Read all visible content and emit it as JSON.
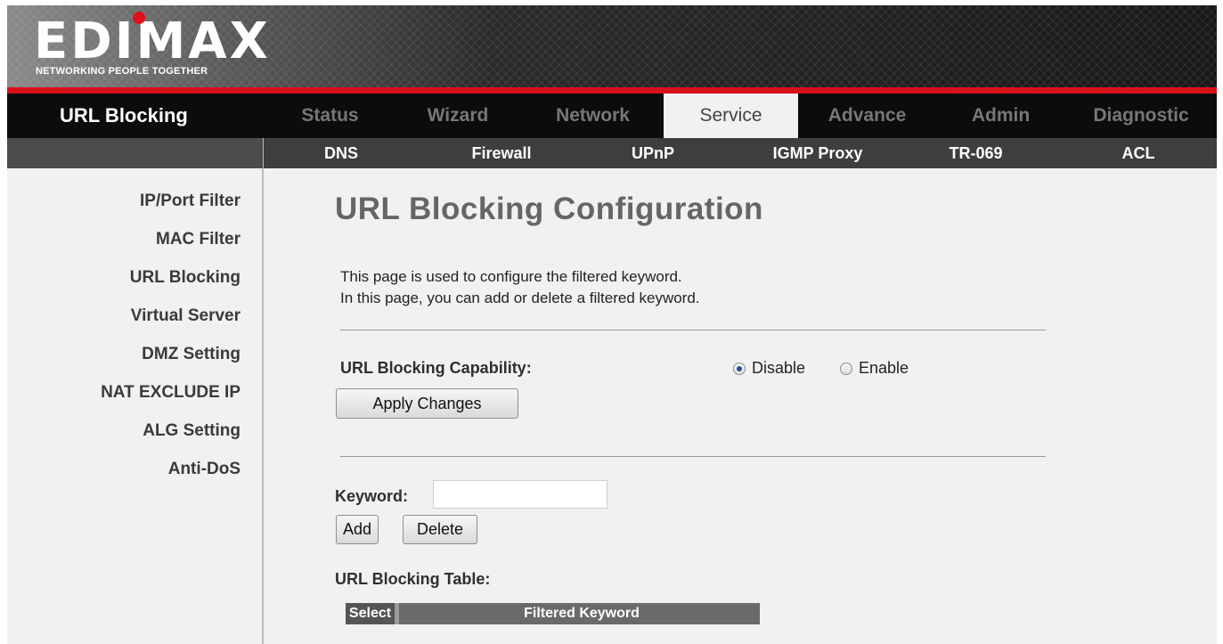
{
  "brand": {
    "logo_text": "EDIMAX",
    "tagline": "NETWORKING PEOPLE TOGETHER",
    "accent_color": "#d8101a"
  },
  "header": {
    "page_title": "URL Blocking"
  },
  "main_nav": {
    "tabs": [
      {
        "label": "Status",
        "active": false
      },
      {
        "label": "Wizard",
        "active": false
      },
      {
        "label": "Network",
        "active": false
      },
      {
        "label": "Service",
        "active": true
      },
      {
        "label": "Advance",
        "active": false
      },
      {
        "label": "Admin",
        "active": false
      },
      {
        "label": "Diagnostic",
        "active": false
      }
    ]
  },
  "sub_nav": {
    "tabs": [
      {
        "label": "DNS"
      },
      {
        "label": "Firewall"
      },
      {
        "label": "UPnP"
      },
      {
        "label": "IGMP Proxy"
      },
      {
        "label": "TR-069"
      },
      {
        "label": "ACL"
      }
    ]
  },
  "sidebar": {
    "items": [
      {
        "label": "IP/Port Filter"
      },
      {
        "label": "MAC Filter"
      },
      {
        "label": "URL Blocking"
      },
      {
        "label": "Virtual Server"
      },
      {
        "label": "DMZ Setting"
      },
      {
        "label": "NAT EXCLUDE IP"
      },
      {
        "label": "ALG Setting"
      },
      {
        "label": "Anti-DoS"
      }
    ]
  },
  "main": {
    "heading": "URL Blocking Configuration",
    "description_line1": "This page is used to configure the filtered keyword.",
    "description_line2": "In this page, you can add or delete a filtered keyword.",
    "capability": {
      "label": "URL Blocking Capability:",
      "options": [
        {
          "label": "Disable",
          "checked": true
        },
        {
          "label": "Enable",
          "checked": false
        }
      ],
      "apply_label": "Apply Changes"
    },
    "keyword": {
      "label": "Keyword:",
      "value": "",
      "add_label": "Add",
      "delete_label": "Delete"
    },
    "table": {
      "title": "URL Blocking Table:",
      "columns": [
        "Select",
        "Filtered Keyword"
      ],
      "rows": []
    }
  }
}
